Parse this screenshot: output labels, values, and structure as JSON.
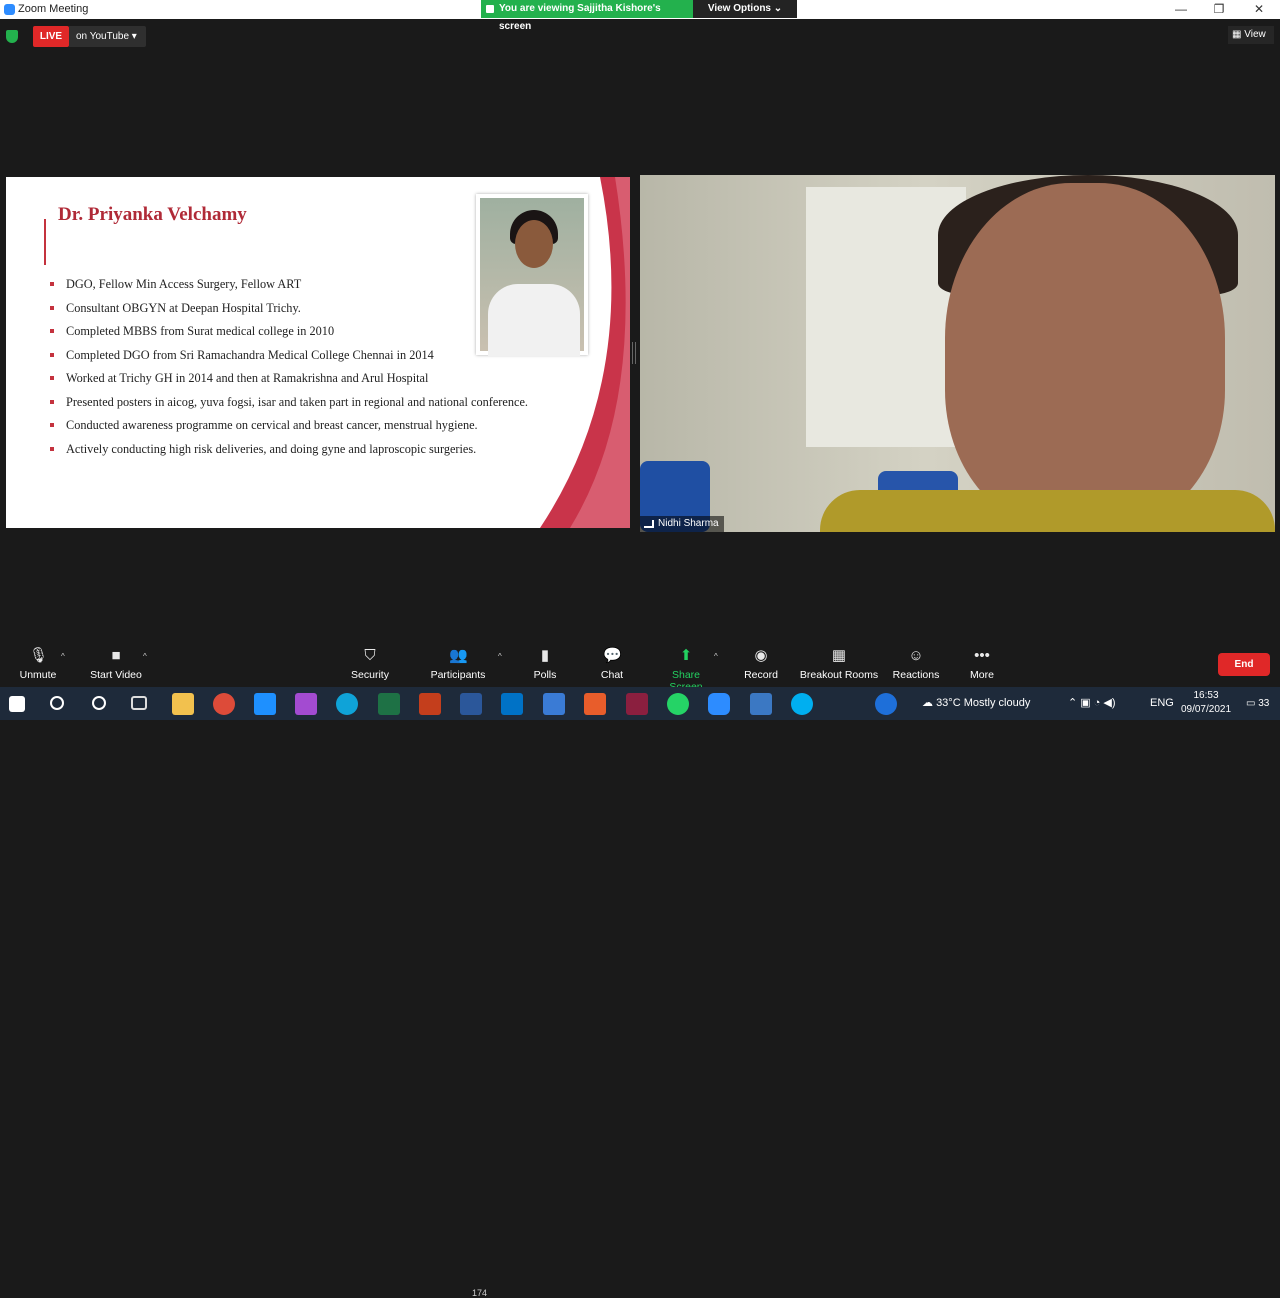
{
  "window": {
    "title": "Zoom Meeting"
  },
  "banner": {
    "viewing": "You are viewing Sajjitha Kishore's screen",
    "view_options": "View Options ⌄"
  },
  "live": {
    "badge": "LIVE",
    "platform": "on YouTube ▾"
  },
  "view_button": "▦ View",
  "slide": {
    "name": "Dr. Priyanka Velchamy",
    "bullets": [
      "DGO, Fellow Min Access Surgery, Fellow ART",
      "Consultant OBGYN at Deepan Hospital Trichy.",
      "Completed MBBS from Surat medical college in 2010",
      "Completed DGO from Sri Ramachandra Medical College Chennai in 2014",
      "Worked at Trichy GH in 2014 and then at Ramakrishna and Arul Hospital",
      "Presented posters in aicog, yuva fogsi, isar and taken part in regional and national conference.",
      "Conducted awareness programme on cervical and breast cancer, menstrual hygiene.",
      "Actively conducting high risk deliveries, and doing gyne and laproscopic surgeries."
    ]
  },
  "participant": {
    "name": "Nidhi Sharma"
  },
  "toolbar": {
    "unmute": "Unmute",
    "start_video": "Start Video",
    "security": "Security",
    "participants": "Participants",
    "participants_count": "174",
    "polls": "Polls",
    "chat": "Chat",
    "share_screen": "Share Screen",
    "record": "Record",
    "breakout_rooms": "Breakout Rooms",
    "reactions": "Reactions",
    "more": "More",
    "end": "End"
  },
  "taskbar": {
    "weather": "33°C  Mostly cloudy",
    "lang": "ENG",
    "time": "16:53",
    "date": "09/07/2021",
    "notif": "33"
  },
  "colors": {
    "accent_red": "#b02a37",
    "zoom_green": "#23b14d",
    "end_red": "#e02828"
  }
}
